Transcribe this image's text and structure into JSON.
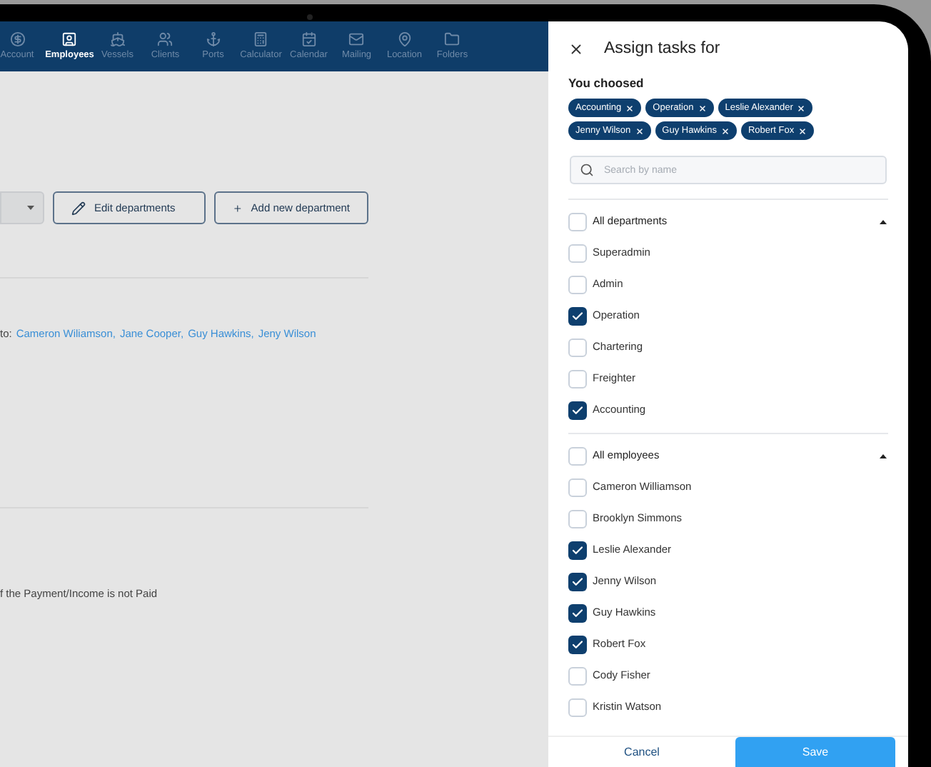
{
  "nav": {
    "items": [
      {
        "label": "Account",
        "selected": false
      },
      {
        "label": "Employees",
        "selected": true
      },
      {
        "label": "Vessels",
        "selected": false
      },
      {
        "label": "Clients",
        "selected": false
      },
      {
        "label": "Ports",
        "selected": false
      },
      {
        "label": "Calculator",
        "selected": false
      },
      {
        "label": "Calendar",
        "selected": false
      },
      {
        "label": "Mailing",
        "selected": false
      },
      {
        "label": "Location",
        "selected": false
      },
      {
        "label": "Folders",
        "selected": false
      }
    ]
  },
  "toolbar": {
    "buttons": [
      {
        "label": "Edit departments"
      },
      {
        "label": "Add new department"
      }
    ]
  },
  "assignment": {
    "prefix": "to:",
    "links": [
      "Cameron Wiliamson,",
      "Jane Cooper,",
      "Guy Hawkins,",
      "Jeny Wilson"
    ]
  },
  "payment_note": "f the Payment/Income is not Paid",
  "drawer": {
    "title": "Assign tasks for",
    "chosen_label": "You choosed",
    "chips": [
      "Accounting",
      "Operation",
      "Leslie Alexander",
      "Jenny Wilson",
      "Guy Hawkins",
      "Robert Fox"
    ],
    "search": {
      "placeholder": "Search by name"
    },
    "groups": [
      {
        "label": "All departments",
        "checked": false,
        "expanded": true,
        "items": [
          {
            "label": "Superadmin",
            "checked": false
          },
          {
            "label": "Admin",
            "checked": false
          },
          {
            "label": "Operation",
            "checked": true
          },
          {
            "label": "Chartering",
            "checked": false
          },
          {
            "label": "Freighter",
            "checked": false
          },
          {
            "label": "Accounting",
            "checked": true
          }
        ]
      },
      {
        "label": "All employees",
        "checked": false,
        "expanded": true,
        "items": [
          {
            "label": "Cameron Williamson",
            "checked": false
          },
          {
            "label": "Brooklyn Simmons",
            "checked": false
          },
          {
            "label": "Leslie Alexander",
            "checked": true
          },
          {
            "label": "Jenny Wilson",
            "checked": true
          },
          {
            "label": "Guy Hawkins",
            "checked": true
          },
          {
            "label": "Robert Fox",
            "checked": true
          },
          {
            "label": "Cody Fisher",
            "checked": false
          },
          {
            "label": "Kristin Watson",
            "checked": false
          }
        ]
      }
    ],
    "cancel": "Cancel",
    "save": "Save"
  }
}
